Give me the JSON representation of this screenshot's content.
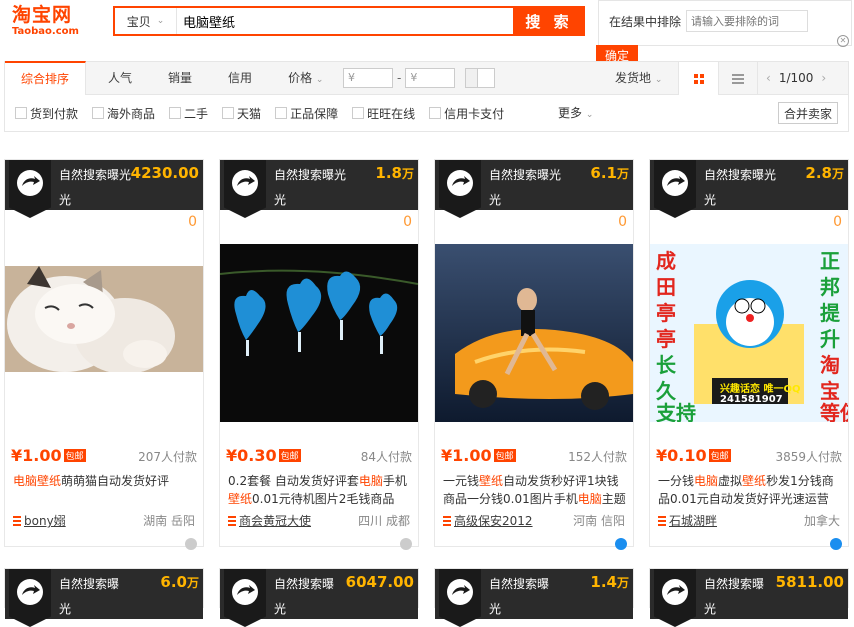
{
  "header": {
    "logo_zh": "淘宝网",
    "logo_en": "Taobao.com",
    "search_category": "宝贝",
    "search_query": "电脑壁纸",
    "search_button": "搜 索",
    "exclude_label": "在结果中排除",
    "exclude_placeholder": "请输入要排除的词",
    "confirm_button": "确定"
  },
  "sort": {
    "tabs": [
      "综合排序",
      "人气",
      "销量",
      "信用",
      "价格"
    ],
    "price_min_placeholder": "¥",
    "price_max_placeholder": "¥",
    "price_dash": "-",
    "ship_from": "发货地",
    "page": "1/100"
  },
  "filters": {
    "items": [
      "货到付款",
      "海外商品",
      "二手",
      "天猫",
      "正品保障",
      "旺旺在线",
      "信用卡支付"
    ],
    "more": "更多",
    "merge": "合并卖家"
  },
  "products": [
    {
      "tag": "自然搜索曝光",
      "amount": "4230.00",
      "unit": "",
      "zero": "0",
      "price": "¥1.00",
      "baoyou": "包邮",
      "sold": "207人付款",
      "title_parts": [
        {
          "t": "电脑壁纸",
          "hl": true
        },
        {
          "t": "萌萌猫自动发货好评",
          "hl": false
        }
      ],
      "shop": "bony嫋",
      "location": "湖南 岳阳",
      "online": false
    },
    {
      "tag": "自然搜索曝光",
      "amount": "1.8",
      "unit": "万",
      "zero": "0",
      "price": "¥0.30",
      "baoyou": "包邮",
      "sold": "84人付款",
      "title_parts": [
        {
          "t": "0.2套餐 自动发货好评套",
          "hl": false
        },
        {
          "t": "电脑",
          "hl": true
        },
        {
          "t": "手机",
          "hl": false
        },
        {
          "t": "壁纸",
          "hl": true
        },
        {
          "t": "0.01元待机图片2毛钱商品",
          "hl": false
        }
      ],
      "shop": "商会黄冠大使",
      "location": "四川 成都",
      "online": false
    },
    {
      "tag": "自然搜索曝光",
      "amount": "6.1",
      "unit": "万",
      "zero": "0",
      "price": "¥1.00",
      "baoyou": "包邮",
      "sold": "152人付款",
      "title_parts": [
        {
          "t": "一元钱",
          "hl": false
        },
        {
          "t": "壁纸",
          "hl": true
        },
        {
          "t": "自动发货秒好评1块钱商品一分钱0.01图片手机",
          "hl": false
        },
        {
          "t": "电脑",
          "hl": true
        },
        {
          "t": "主题",
          "hl": false
        }
      ],
      "shop": "高级保安2012",
      "location": "河南 信阳",
      "online": true
    },
    {
      "tag": "自然搜索曝光",
      "amount": "2.8",
      "unit": "万",
      "zero": "0",
      "price": "¥0.10",
      "baoyou": "包邮",
      "sold": "3859人付款",
      "title_parts": [
        {
          "t": "一分钱",
          "hl": false
        },
        {
          "t": "电脑",
          "hl": true
        },
        {
          "t": "虚拟",
          "hl": false
        },
        {
          "t": "壁纸",
          "hl": true
        },
        {
          "t": "秒发1分钱商品0.01元自动发货好评光速运营",
          "hl": false
        }
      ],
      "shop": "石城湖畔",
      "location": "加拿大",
      "online": true
    }
  ],
  "products_row2": [
    {
      "tag": "自然搜索曝",
      "amount": "6.0",
      "unit": "万"
    },
    {
      "tag": "自然搜索曝",
      "amount": "6047.00",
      "unit": ""
    },
    {
      "tag": "自然搜索曝",
      "amount": "1.4",
      "unit": "万"
    },
    {
      "tag": "自然搜索曝",
      "amount": "5811.00",
      "unit": ""
    }
  ],
  "tag_suffix": "光",
  "poster_text": {
    "left": "成田亭亭长久支持",
    "right": "正邦提升淘宝等仞",
    "center": "兴趣话恋 唯一QQ",
    "qq": "241581907"
  }
}
